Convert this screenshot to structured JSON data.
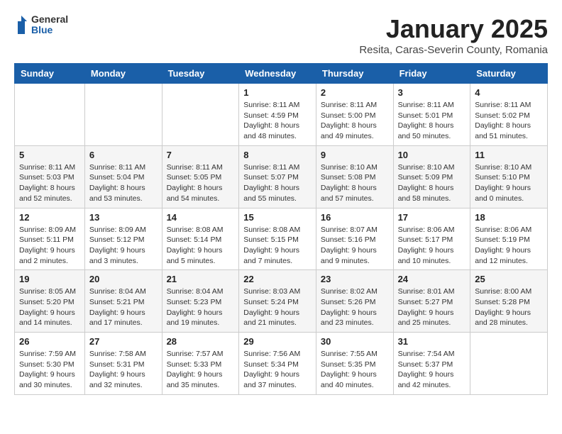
{
  "header": {
    "logo": {
      "line1": "General",
      "line2": "Blue"
    },
    "title": "January 2025",
    "subtitle": "Resita, Caras-Severin County, Romania"
  },
  "weekdays": [
    "Sunday",
    "Monday",
    "Tuesday",
    "Wednesday",
    "Thursday",
    "Friday",
    "Saturday"
  ],
  "weeks": [
    [
      {
        "day": "",
        "info": ""
      },
      {
        "day": "",
        "info": ""
      },
      {
        "day": "",
        "info": ""
      },
      {
        "day": "1",
        "info": "Sunrise: 8:11 AM\nSunset: 4:59 PM\nDaylight: 8 hours\nand 48 minutes."
      },
      {
        "day": "2",
        "info": "Sunrise: 8:11 AM\nSunset: 5:00 PM\nDaylight: 8 hours\nand 49 minutes."
      },
      {
        "day": "3",
        "info": "Sunrise: 8:11 AM\nSunset: 5:01 PM\nDaylight: 8 hours\nand 50 minutes."
      },
      {
        "day": "4",
        "info": "Sunrise: 8:11 AM\nSunset: 5:02 PM\nDaylight: 8 hours\nand 51 minutes."
      }
    ],
    [
      {
        "day": "5",
        "info": "Sunrise: 8:11 AM\nSunset: 5:03 PM\nDaylight: 8 hours\nand 52 minutes."
      },
      {
        "day": "6",
        "info": "Sunrise: 8:11 AM\nSunset: 5:04 PM\nDaylight: 8 hours\nand 53 minutes."
      },
      {
        "day": "7",
        "info": "Sunrise: 8:11 AM\nSunset: 5:05 PM\nDaylight: 8 hours\nand 54 minutes."
      },
      {
        "day": "8",
        "info": "Sunrise: 8:11 AM\nSunset: 5:07 PM\nDaylight: 8 hours\nand 55 minutes."
      },
      {
        "day": "9",
        "info": "Sunrise: 8:10 AM\nSunset: 5:08 PM\nDaylight: 8 hours\nand 57 minutes."
      },
      {
        "day": "10",
        "info": "Sunrise: 8:10 AM\nSunset: 5:09 PM\nDaylight: 8 hours\nand 58 minutes."
      },
      {
        "day": "11",
        "info": "Sunrise: 8:10 AM\nSunset: 5:10 PM\nDaylight: 9 hours\nand 0 minutes."
      }
    ],
    [
      {
        "day": "12",
        "info": "Sunrise: 8:09 AM\nSunset: 5:11 PM\nDaylight: 9 hours\nand 2 minutes."
      },
      {
        "day": "13",
        "info": "Sunrise: 8:09 AM\nSunset: 5:12 PM\nDaylight: 9 hours\nand 3 minutes."
      },
      {
        "day": "14",
        "info": "Sunrise: 8:08 AM\nSunset: 5:14 PM\nDaylight: 9 hours\nand 5 minutes."
      },
      {
        "day": "15",
        "info": "Sunrise: 8:08 AM\nSunset: 5:15 PM\nDaylight: 9 hours\nand 7 minutes."
      },
      {
        "day": "16",
        "info": "Sunrise: 8:07 AM\nSunset: 5:16 PM\nDaylight: 9 hours\nand 9 minutes."
      },
      {
        "day": "17",
        "info": "Sunrise: 8:06 AM\nSunset: 5:17 PM\nDaylight: 9 hours\nand 10 minutes."
      },
      {
        "day": "18",
        "info": "Sunrise: 8:06 AM\nSunset: 5:19 PM\nDaylight: 9 hours\nand 12 minutes."
      }
    ],
    [
      {
        "day": "19",
        "info": "Sunrise: 8:05 AM\nSunset: 5:20 PM\nDaylight: 9 hours\nand 14 minutes."
      },
      {
        "day": "20",
        "info": "Sunrise: 8:04 AM\nSunset: 5:21 PM\nDaylight: 9 hours\nand 17 minutes."
      },
      {
        "day": "21",
        "info": "Sunrise: 8:04 AM\nSunset: 5:23 PM\nDaylight: 9 hours\nand 19 minutes."
      },
      {
        "day": "22",
        "info": "Sunrise: 8:03 AM\nSunset: 5:24 PM\nDaylight: 9 hours\nand 21 minutes."
      },
      {
        "day": "23",
        "info": "Sunrise: 8:02 AM\nSunset: 5:26 PM\nDaylight: 9 hours\nand 23 minutes."
      },
      {
        "day": "24",
        "info": "Sunrise: 8:01 AM\nSunset: 5:27 PM\nDaylight: 9 hours\nand 25 minutes."
      },
      {
        "day": "25",
        "info": "Sunrise: 8:00 AM\nSunset: 5:28 PM\nDaylight: 9 hours\nand 28 minutes."
      }
    ],
    [
      {
        "day": "26",
        "info": "Sunrise: 7:59 AM\nSunset: 5:30 PM\nDaylight: 9 hours\nand 30 minutes."
      },
      {
        "day": "27",
        "info": "Sunrise: 7:58 AM\nSunset: 5:31 PM\nDaylight: 9 hours\nand 32 minutes."
      },
      {
        "day": "28",
        "info": "Sunrise: 7:57 AM\nSunset: 5:33 PM\nDaylight: 9 hours\nand 35 minutes."
      },
      {
        "day": "29",
        "info": "Sunrise: 7:56 AM\nSunset: 5:34 PM\nDaylight: 9 hours\nand 37 minutes."
      },
      {
        "day": "30",
        "info": "Sunrise: 7:55 AM\nSunset: 5:35 PM\nDaylight: 9 hours\nand 40 minutes."
      },
      {
        "day": "31",
        "info": "Sunrise: 7:54 AM\nSunset: 5:37 PM\nDaylight: 9 hours\nand 42 minutes."
      },
      {
        "day": "",
        "info": ""
      }
    ]
  ]
}
